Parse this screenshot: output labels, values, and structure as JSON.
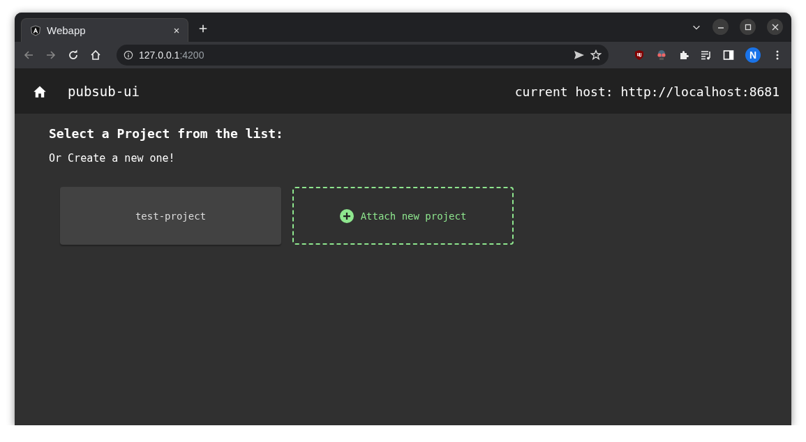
{
  "browser": {
    "tabs": [
      {
        "title": "Webapp",
        "selected": true
      }
    ],
    "url": {
      "host": "127.0.0.1",
      "port": ":4200"
    },
    "profile_initial": "N"
  },
  "app_bar": {
    "title": "pubsub-ui",
    "host_label": "current host: http://localhost:8681"
  },
  "content": {
    "heading": "Select a Project from the list:",
    "subheading": "Or Create a new one!",
    "projects": [
      {
        "name": "test-project"
      }
    ],
    "attach_button": "Attach new project"
  }
}
